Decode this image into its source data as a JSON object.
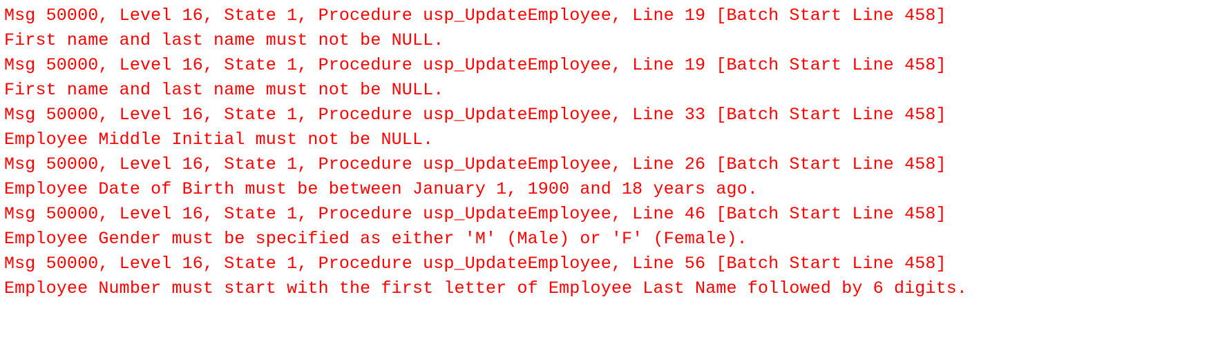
{
  "messages": {
    "text_color": "#ff0000",
    "lines": [
      "Msg 50000, Level 16, State 1, Procedure usp_UpdateEmployee, Line 19 [Batch Start Line 458]",
      "First name and last name must not be NULL.",
      "Msg 50000, Level 16, State 1, Procedure usp_UpdateEmployee, Line 19 [Batch Start Line 458]",
      "First name and last name must not be NULL.",
      "Msg 50000, Level 16, State 1, Procedure usp_UpdateEmployee, Line 33 [Batch Start Line 458]",
      "Employee Middle Initial must not be NULL.",
      "Msg 50000, Level 16, State 1, Procedure usp_UpdateEmployee, Line 26 [Batch Start Line 458]",
      "Employee Date of Birth must be between January 1, 1900 and 18 years ago.",
      "Msg 50000, Level 16, State 1, Procedure usp_UpdateEmployee, Line 46 [Batch Start Line 458]",
      "Employee Gender must be specified as either 'M' (Male) or 'F' (Female).",
      "Msg 50000, Level 16, State 1, Procedure usp_UpdateEmployee, Line 56 [Batch Start Line 458]",
      "Employee Number must start with the first letter of Employee Last Name followed by 6 digits."
    ]
  }
}
